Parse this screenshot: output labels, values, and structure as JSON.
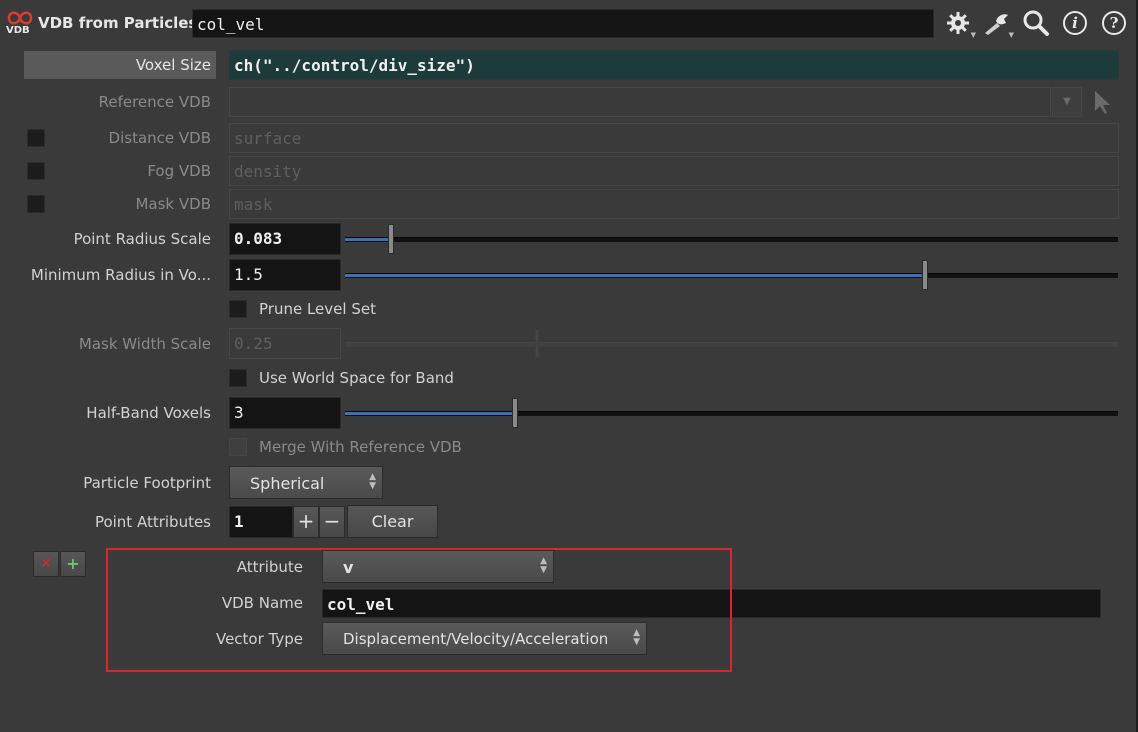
{
  "header": {
    "node_type": "VDB from Particles",
    "node_icon_text": "VDB",
    "node_name": "col_vel",
    "icons": [
      "gear-icon",
      "wrench-icon",
      "search-icon",
      "info-icon",
      "help-icon"
    ],
    "info_glyph": "i",
    "help_glyph": "?"
  },
  "params": {
    "voxel_size": {
      "label": "Voxel Size",
      "value": "ch(\"../control/div_size\")"
    },
    "reference_vdb": {
      "label": "Reference VDB",
      "value": ""
    },
    "distance_vdb": {
      "label": "Distance VDB",
      "placeholder": "surface"
    },
    "fog_vdb": {
      "label": "Fog VDB",
      "placeholder": "density"
    },
    "mask_vdb": {
      "label": "Mask VDB",
      "placeholder": "mask"
    },
    "point_radius_scale": {
      "label": "Point Radius Scale",
      "value": "0.083",
      "slider": 0.06
    },
    "min_radius": {
      "label": "Minimum Radius in Vo...",
      "value": "1.5",
      "slider": 0.75
    },
    "prune_level_set": {
      "label": "Prune Level Set"
    },
    "mask_width_scale": {
      "label": "Mask Width Scale",
      "value": "0.25",
      "slider": 0.25
    },
    "use_world_space": {
      "label": "Use World Space for Band"
    },
    "half_band_voxels": {
      "label": "Half-Band Voxels",
      "value": "3",
      "slider": 0.22
    },
    "merge_reference": {
      "label": "Merge With Reference VDB"
    },
    "particle_footprint": {
      "label": "Particle Footprint",
      "value": "Spherical"
    },
    "point_attributes": {
      "label": "Point Attributes",
      "count": "1",
      "plus": "+",
      "minus": "−",
      "clear": "Clear"
    }
  },
  "multiparm": {
    "remove_glyph": "✕",
    "insert_glyph": "+",
    "attribute": {
      "label": "Attribute",
      "value": "v"
    },
    "vdb_name": {
      "label": "VDB Name",
      "value": "col_vel"
    },
    "vector_type": {
      "label": "Vector Type",
      "value": "Displacement/Velocity/Acceleration"
    }
  },
  "colors": {
    "accent_slider": "#3c6fb8",
    "highlight_box": "#d8262e",
    "voxel_field_bg": "#1d3b3a"
  }
}
